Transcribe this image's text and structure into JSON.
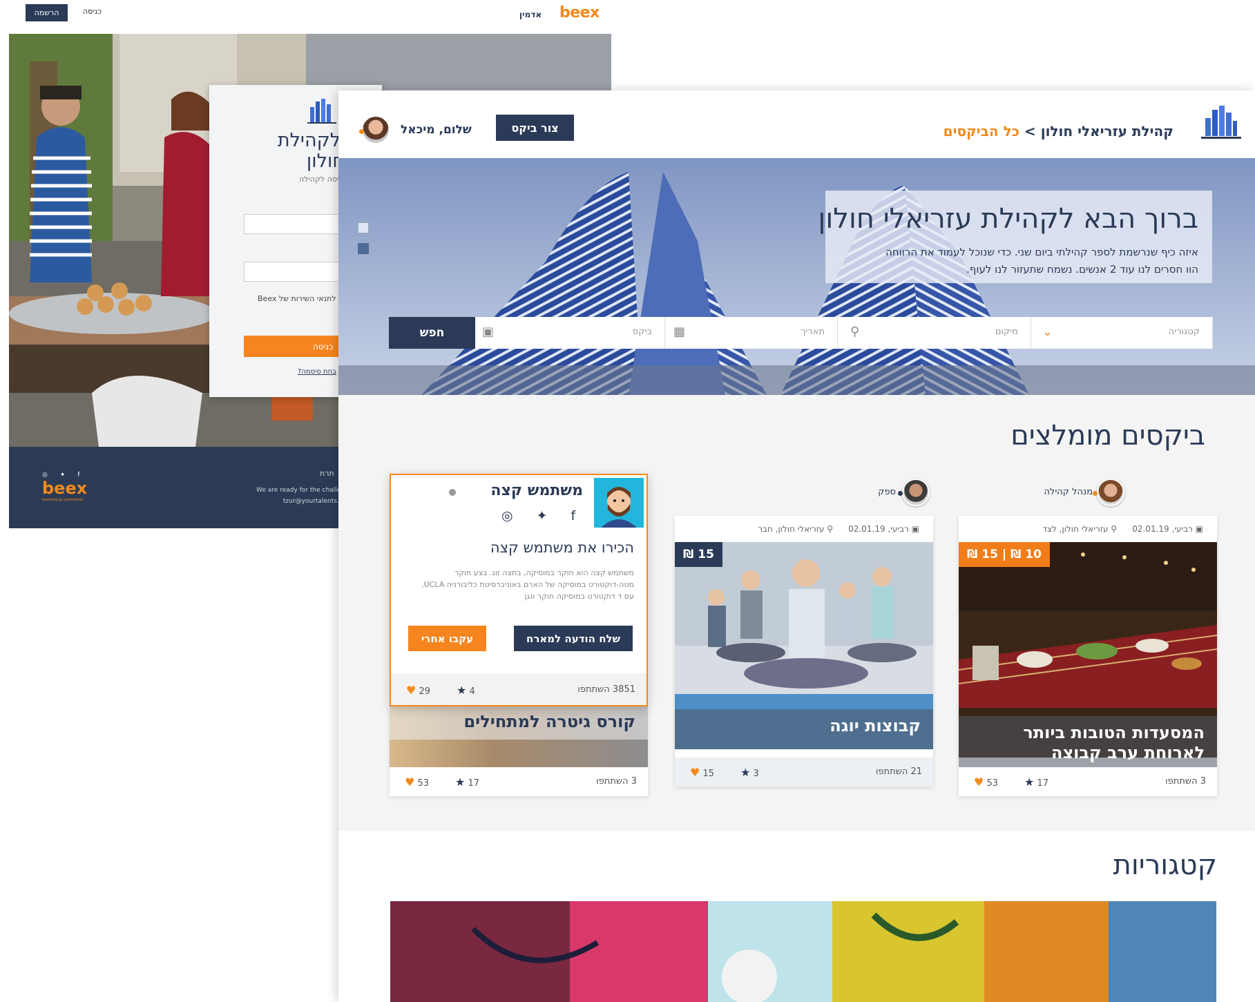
{
  "back_window": {
    "register_btn": "הרשמה",
    "login_link": "כניסה",
    "admin_link": "אדמין",
    "logo": "beex",
    "login_modal": {
      "title_line1": "הבא לקהילת",
      "title_line2": "יאלי חולון",
      "subtitle": "יסה לקהילה",
      "terms": "Beex לתנאי השירות של",
      "login_btn": "כניסה",
      "forgot": "?בחת סיסמה"
    },
    "footer": {
      "logo": "beex",
      "tagline": "teaching by yourtalents",
      "title": "תרת",
      "text1": "We are ready for the challeng",
      "text2": "tzur@yourtalents.m"
    }
  },
  "front_window": {
    "breadcrumb_community": "קהילת עזריאלי חולון",
    "breadcrumb_separator": ">",
    "breadcrumb_link": "כל הביקסים",
    "create_btn": "צור ביקס",
    "greeting": "שלום, מיכאל",
    "hero": {
      "title": "ברוך הבא לקהילת עזריאלי חולון",
      "text_line1": "איזה כיף שנרשמת לספר קהילתי ביום שני. כדי שנוכל לעמוד את הרווחה",
      "text_line2": "הוו חסרים לנו עוד 2 אנשים. נשמח שתעזור לנו לעוף."
    },
    "search": {
      "button": "חפש",
      "category_placeholder": "קטגוריה",
      "location_placeholder": "מיקום",
      "date_placeholder": "תאריך",
      "when_placeholder": "ביקס"
    },
    "recommended_title": "ביקסים מומלצים",
    "categories_title": "קטגוריות",
    "cards": [
      {
        "organizer": "מנהל קהילה",
        "date": "רביעי, 02.01.19",
        "location": "עזריאלי חולון, לצד",
        "price": "10 ₪ | 15 ₪",
        "caption": "המסעדות הטובות ביותר לארוחת ערב קבוצה",
        "likes": "53",
        "stars": "17",
        "participants": "3 השתתפו"
      },
      {
        "organizer": "ספק",
        "date": "רביעי, 02.01.19",
        "location": "עזריאלי חולון, חבר",
        "price": "15 ₪",
        "caption": "קבוצות יוגה",
        "likes": "15",
        "stars": "3",
        "participants": "21 השתתפו"
      },
      {
        "caption": "קורס גיטרה למתחילים",
        "likes": "53",
        "stars": "17",
        "participants": "3 השתתפו"
      }
    ],
    "profile_card": {
      "name": "משתמש קצה",
      "heading": "הכירו את משתמש קצה",
      "bio": "משתמש קצה הוא חוקר במוסיקה, בתצה זוג. בצע חוקר מטה-דוקטורט במוסיקה של הארם באוניברסיטת כליבורניה UCLA, עם ד דוקטורט במוסיקה חוקר ונגן",
      "message_btn": "שלח הודעה למארח",
      "follow_btn": "עקבו אחרי",
      "likes": "29",
      "stars": "4",
      "participants": "3851 השתתפו"
    }
  }
}
